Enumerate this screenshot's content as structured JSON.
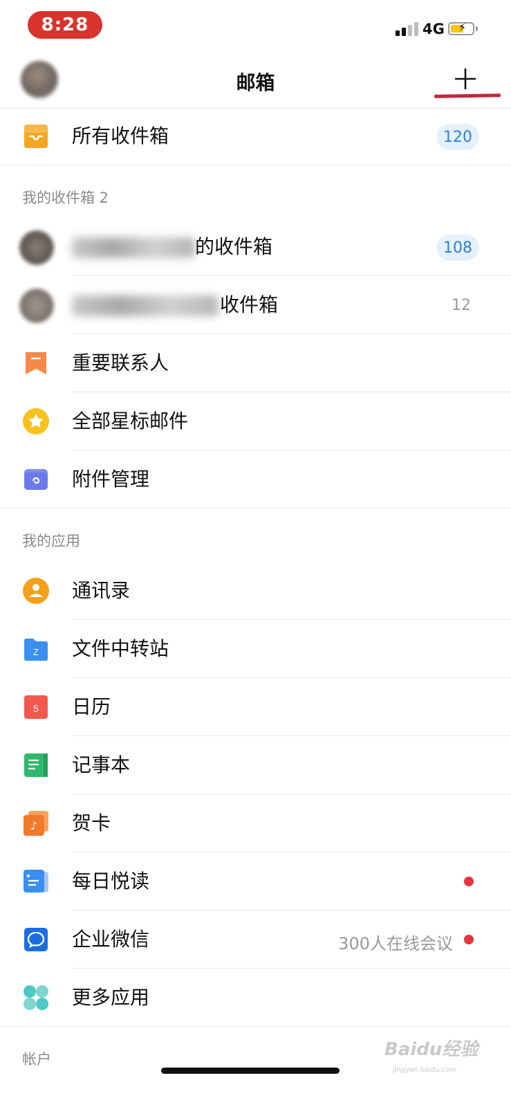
{
  "status_bar": {
    "time": "8:28",
    "network": "4G"
  },
  "nav": {
    "title": "邮箱",
    "add_icon": "plus-icon"
  },
  "all_inbox": {
    "label": "所有收件箱",
    "badge": "120",
    "icon": "inbox-tray-icon",
    "color": "#f5a623"
  },
  "section_my_inboxes": {
    "title": "我的收件箱 2"
  },
  "inboxes": [
    {
      "label_suffix": "的收件箱",
      "badge": "108"
    },
    {
      "label_suffix": "收件箱",
      "count": "12"
    }
  ],
  "mail_items": [
    {
      "label": "重要联系人",
      "icon": "bookmark-icon"
    },
    {
      "label": "全部星标邮件",
      "icon": "star-icon"
    },
    {
      "label": "附件管理",
      "icon": "attachment-folder-icon"
    }
  ],
  "section_apps": {
    "title": "我的应用"
  },
  "apps": [
    {
      "label": "通讯录",
      "icon": "contacts-icon"
    },
    {
      "label": "文件中转站",
      "icon": "folder-z-icon",
      "glyph": "Z"
    },
    {
      "label": "日历",
      "icon": "calendar-icon",
      "glyph": "5"
    },
    {
      "label": "记事本",
      "icon": "notepad-icon"
    },
    {
      "label": "贺卡",
      "icon": "greeting-card-icon",
      "glyph": "♪"
    },
    {
      "label": "每日悦读",
      "icon": "daily-reading-icon"
    },
    {
      "label": "企业微信",
      "icon": "wecom-icon",
      "subinfo": "300人在线会议"
    },
    {
      "label": "更多应用",
      "icon": "more-apps-icon"
    }
  ],
  "section_account": {
    "title": "帐户"
  },
  "watermark": {
    "text": "Baidu经验",
    "sub": "jingyan.baidu.com"
  }
}
